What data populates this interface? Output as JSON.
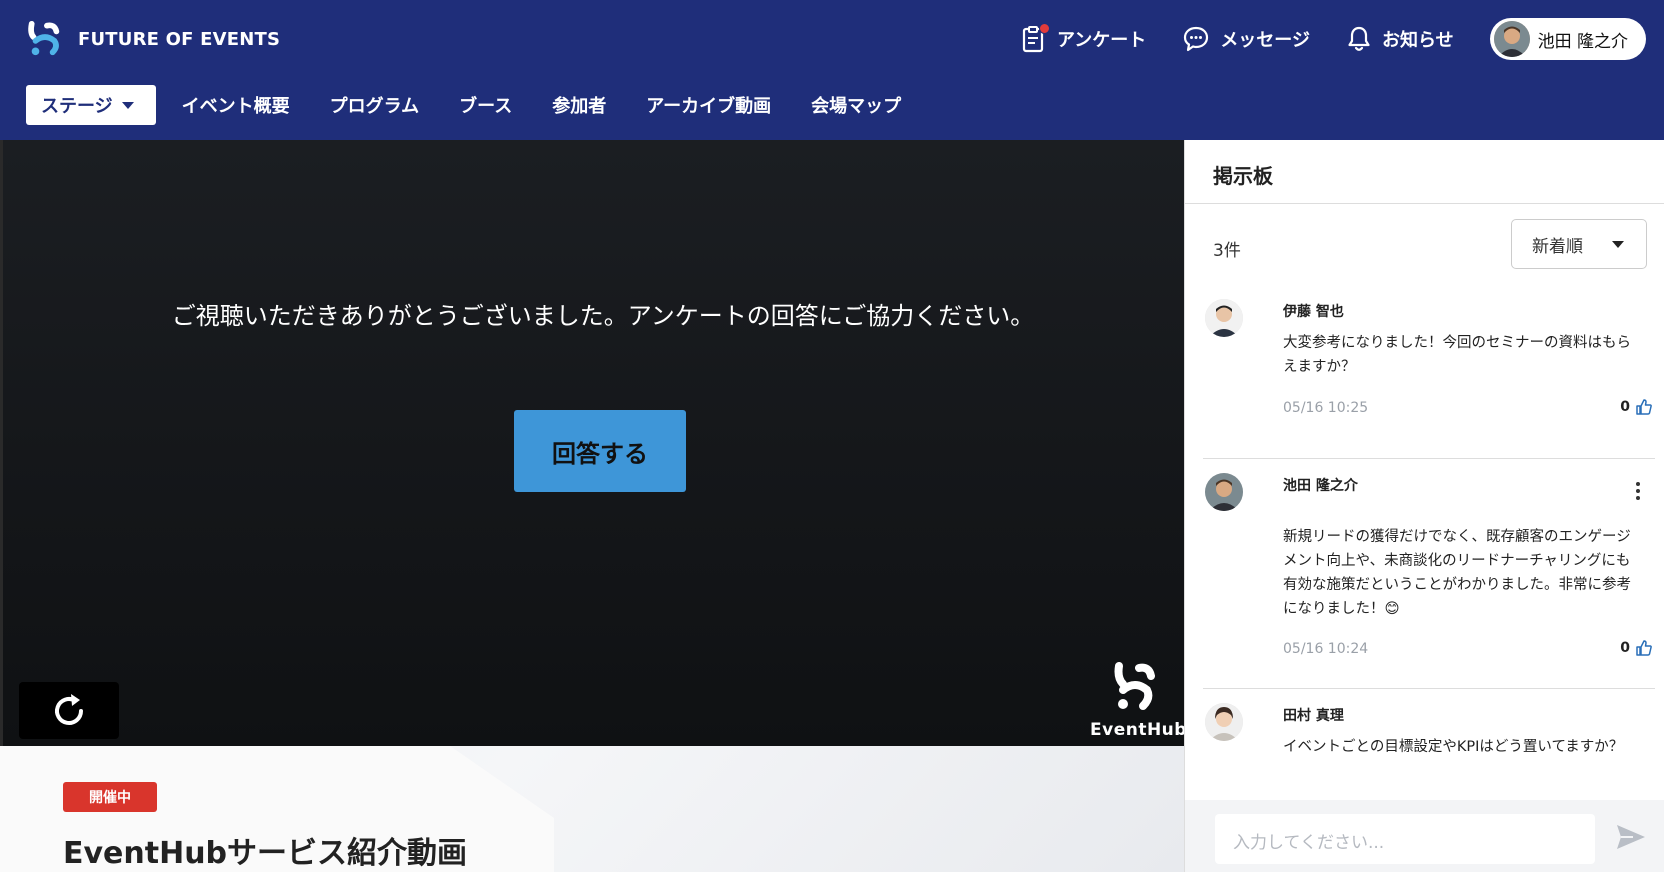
{
  "header": {
    "brand": "FUTURE OF EVENTS",
    "actions": {
      "survey": "アンケート",
      "messages": "メッセージ",
      "notifications": "お知らせ"
    },
    "user": {
      "name": "池田 隆之介"
    }
  },
  "nav": {
    "stage": "ステージ",
    "items": [
      "イベント概要",
      "プログラム",
      "ブース",
      "参加者",
      "アーカイブ動画",
      "会場マップ"
    ]
  },
  "video": {
    "message": "ご視聴いただきありがとうございました。アンケートの回答にご協力ください。",
    "answer_button": "回答する",
    "watermark": "EventHub"
  },
  "session": {
    "status": "開催中",
    "title": "EventHubサービス紹介動画"
  },
  "board": {
    "title": "掲示板",
    "count": "3件",
    "sort": "新着順",
    "posts": [
      {
        "author": "伊藤 智也",
        "body": "大変参考になりました！今回のセミナーの資料はもらえますか？",
        "time": "05/16 10:25",
        "likes": "0"
      },
      {
        "author": "池田 隆之介",
        "body": "新規リードの獲得だけでなく、既存顧客のエンゲージメント向上や、未商談化のリードナーチャリングにも有効な施策だということがわかりました。非常に参考になりました！😊",
        "time": "05/16 10:24",
        "likes": "0"
      },
      {
        "author": "田村 真理",
        "body": "イベントごとの目標設定やKPIはどう置いてますか？",
        "time": "",
        "likes": ""
      }
    ],
    "composer_placeholder": "入力してください..."
  },
  "colors": {
    "header_bg": "#1f2e7a",
    "answer_button": "#3e96d8",
    "live_badge": "#d9352c"
  }
}
